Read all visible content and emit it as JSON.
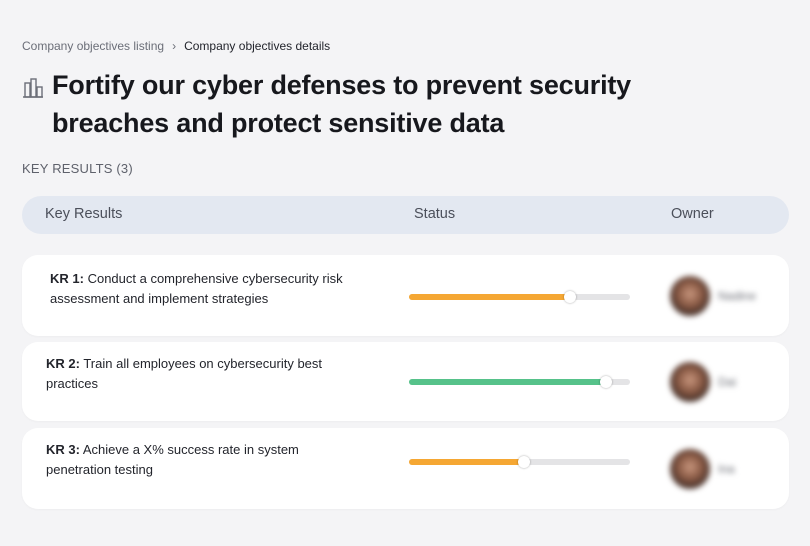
{
  "breadcrumb": {
    "parent": "Company objectives listing",
    "separator": "›",
    "current": "Company objectives details"
  },
  "objective": {
    "icon": "building-chart-icon",
    "title": "Fortify our cyber defenses to prevent security breaches and protect sensitive data"
  },
  "key_results_section": {
    "label": "KEY RESULTS (3)"
  },
  "table": {
    "headers": {
      "key_results": "Key Results",
      "status": "Status",
      "owner": "Owner"
    },
    "rows": [
      {
        "prefix": "KR 1:",
        "text": "Conduct a comprehensive cybersecurity risk assessment and implement strategies",
        "progress": 0.73,
        "progress_color": "#f5a733",
        "owner_name": "Nadine"
      },
      {
        "prefix": "KR 2:",
        "text": "Train all employees on cybersecurity best practices",
        "progress": 0.89,
        "progress_color": "#56c28a",
        "owner_name": "Dai"
      },
      {
        "prefix": "KR 3:",
        "text": "Achieve a X% success rate in system penetration testing",
        "progress": 0.52,
        "progress_color": "#f5a733",
        "owner_name": "Ina"
      }
    ]
  }
}
